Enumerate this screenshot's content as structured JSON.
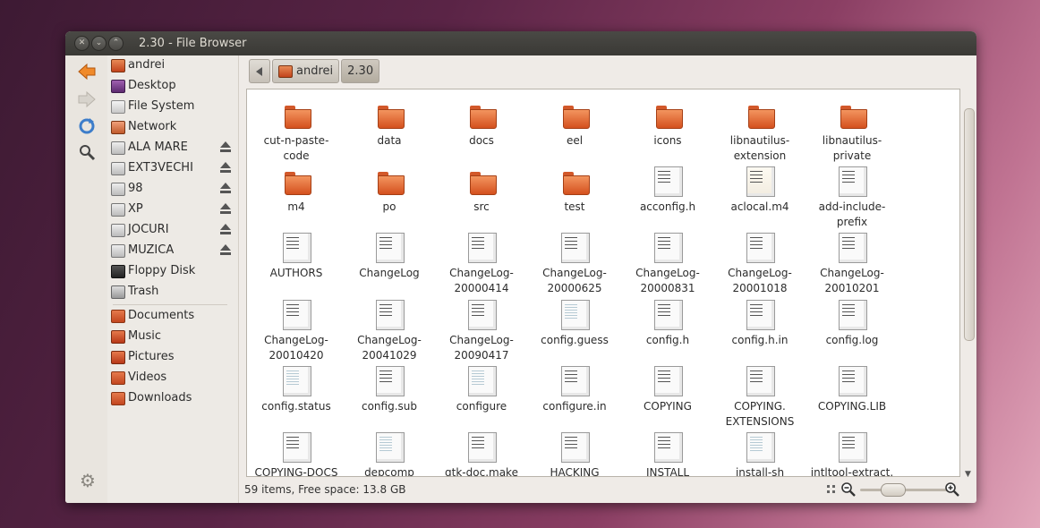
{
  "window": {
    "title": "2.30 - File Browser",
    "controls": [
      "close-icon",
      "minimize-icon",
      "maximize-icon"
    ]
  },
  "toolbar": {
    "back_icon": "back-arrow-icon",
    "forward_icon": "forward-arrow-icon",
    "reload_icon": "reload-icon",
    "search_icon": "search-icon",
    "settings_icon": "gear-icon"
  },
  "sidebar": {
    "places": [
      {
        "label": "andrei",
        "icon": "home-folder-icon"
      },
      {
        "label": "Desktop",
        "icon": "desktop-icon"
      },
      {
        "label": "File System",
        "icon": "filesystem-icon"
      },
      {
        "label": "Network",
        "icon": "network-icon"
      },
      {
        "label": "ALA MARE",
        "icon": "drive-icon",
        "eject": true
      },
      {
        "label": "EXT3VECHI",
        "icon": "drive-icon",
        "eject": true
      },
      {
        "label": "98",
        "icon": "drive-icon",
        "eject": true
      },
      {
        "label": "XP",
        "icon": "drive-icon",
        "eject": true
      },
      {
        "label": "JOCURI",
        "icon": "drive-icon",
        "eject": true
      },
      {
        "label": "MUZICA",
        "icon": "drive-icon",
        "eject": true
      },
      {
        "label": "Floppy Disk",
        "icon": "floppy-icon"
      },
      {
        "label": "Trash",
        "icon": "trash-icon"
      }
    ],
    "bookmarks": [
      {
        "label": "Documents",
        "icon": "folder-icon"
      },
      {
        "label": "Music",
        "icon": "music-folder-icon"
      },
      {
        "label": "Pictures",
        "icon": "pictures-folder-icon"
      },
      {
        "label": "Videos",
        "icon": "videos-folder-icon"
      },
      {
        "label": "Downloads",
        "icon": "downloads-folder-icon"
      }
    ]
  },
  "pathbar": {
    "back_icon": "path-left-icon",
    "segments": [
      "andrei",
      "2.30"
    ]
  },
  "files": [
    {
      "name": "cut-n-paste-\ncode",
      "type": "folder"
    },
    {
      "name": "data",
      "type": "folder"
    },
    {
      "name": "docs",
      "type": "folder"
    },
    {
      "name": "eel",
      "type": "folder"
    },
    {
      "name": "icons",
      "type": "folder"
    },
    {
      "name": "libnautilus-\nextension",
      "type": "folder"
    },
    {
      "name": "libnautilus-\nprivate",
      "type": "folder"
    },
    {
      "name": "m4",
      "type": "folder"
    },
    {
      "name": "po",
      "type": "folder"
    },
    {
      "name": "src",
      "type": "folder"
    },
    {
      "name": "test",
      "type": "folder"
    },
    {
      "name": "acconfig.h",
      "type": "text"
    },
    {
      "name": "aclocal.m4",
      "type": "note"
    },
    {
      "name": "add-include-\nprefix",
      "type": "text"
    },
    {
      "name": "AUTHORS",
      "type": "text"
    },
    {
      "name": "ChangeLog",
      "type": "text"
    },
    {
      "name": "ChangeLog-\n20000414",
      "type": "text"
    },
    {
      "name": "ChangeLog-\n20000625",
      "type": "text"
    },
    {
      "name": "ChangeLog-\n20000831",
      "type": "text"
    },
    {
      "name": "ChangeLog-\n20001018",
      "type": "text"
    },
    {
      "name": "ChangeLog-\n20010201",
      "type": "text"
    },
    {
      "name": "ChangeLog-\n20010420",
      "type": "text"
    },
    {
      "name": "ChangeLog-\n20041029",
      "type": "text"
    },
    {
      "name": "ChangeLog-\n20090417",
      "type": "text"
    },
    {
      "name": "config.guess",
      "type": "plain"
    },
    {
      "name": "config.h",
      "type": "text"
    },
    {
      "name": "config.h.in",
      "type": "text"
    },
    {
      "name": "config.log",
      "type": "text"
    },
    {
      "name": "config.status",
      "type": "plain"
    },
    {
      "name": "config.sub",
      "type": "text"
    },
    {
      "name": "configure",
      "type": "plain"
    },
    {
      "name": "configure.in",
      "type": "text"
    },
    {
      "name": "COPYING",
      "type": "text"
    },
    {
      "name": "COPYING.\nEXTENSIONS",
      "type": "text"
    },
    {
      "name": "COPYING.LIB",
      "type": "text"
    },
    {
      "name": "COPYING-DOCS",
      "type": "text"
    },
    {
      "name": "depcomp",
      "type": "plain"
    },
    {
      "name": "gtk-doc.make",
      "type": "text"
    },
    {
      "name": "HACKING",
      "type": "text"
    },
    {
      "name": "INSTALL",
      "type": "text"
    },
    {
      "name": "install-sh",
      "type": "plain"
    },
    {
      "name": "intltool-extract.",
      "type": "text"
    }
  ],
  "status": {
    "text": "59 items, Free space: 13.8 GB"
  },
  "zoom": {
    "zoom_out_icon": "zoom-out-icon",
    "zoom_in_icon": "zoom-in-icon",
    "compact_icon": "compact-view-icon",
    "level": 0.3
  }
}
